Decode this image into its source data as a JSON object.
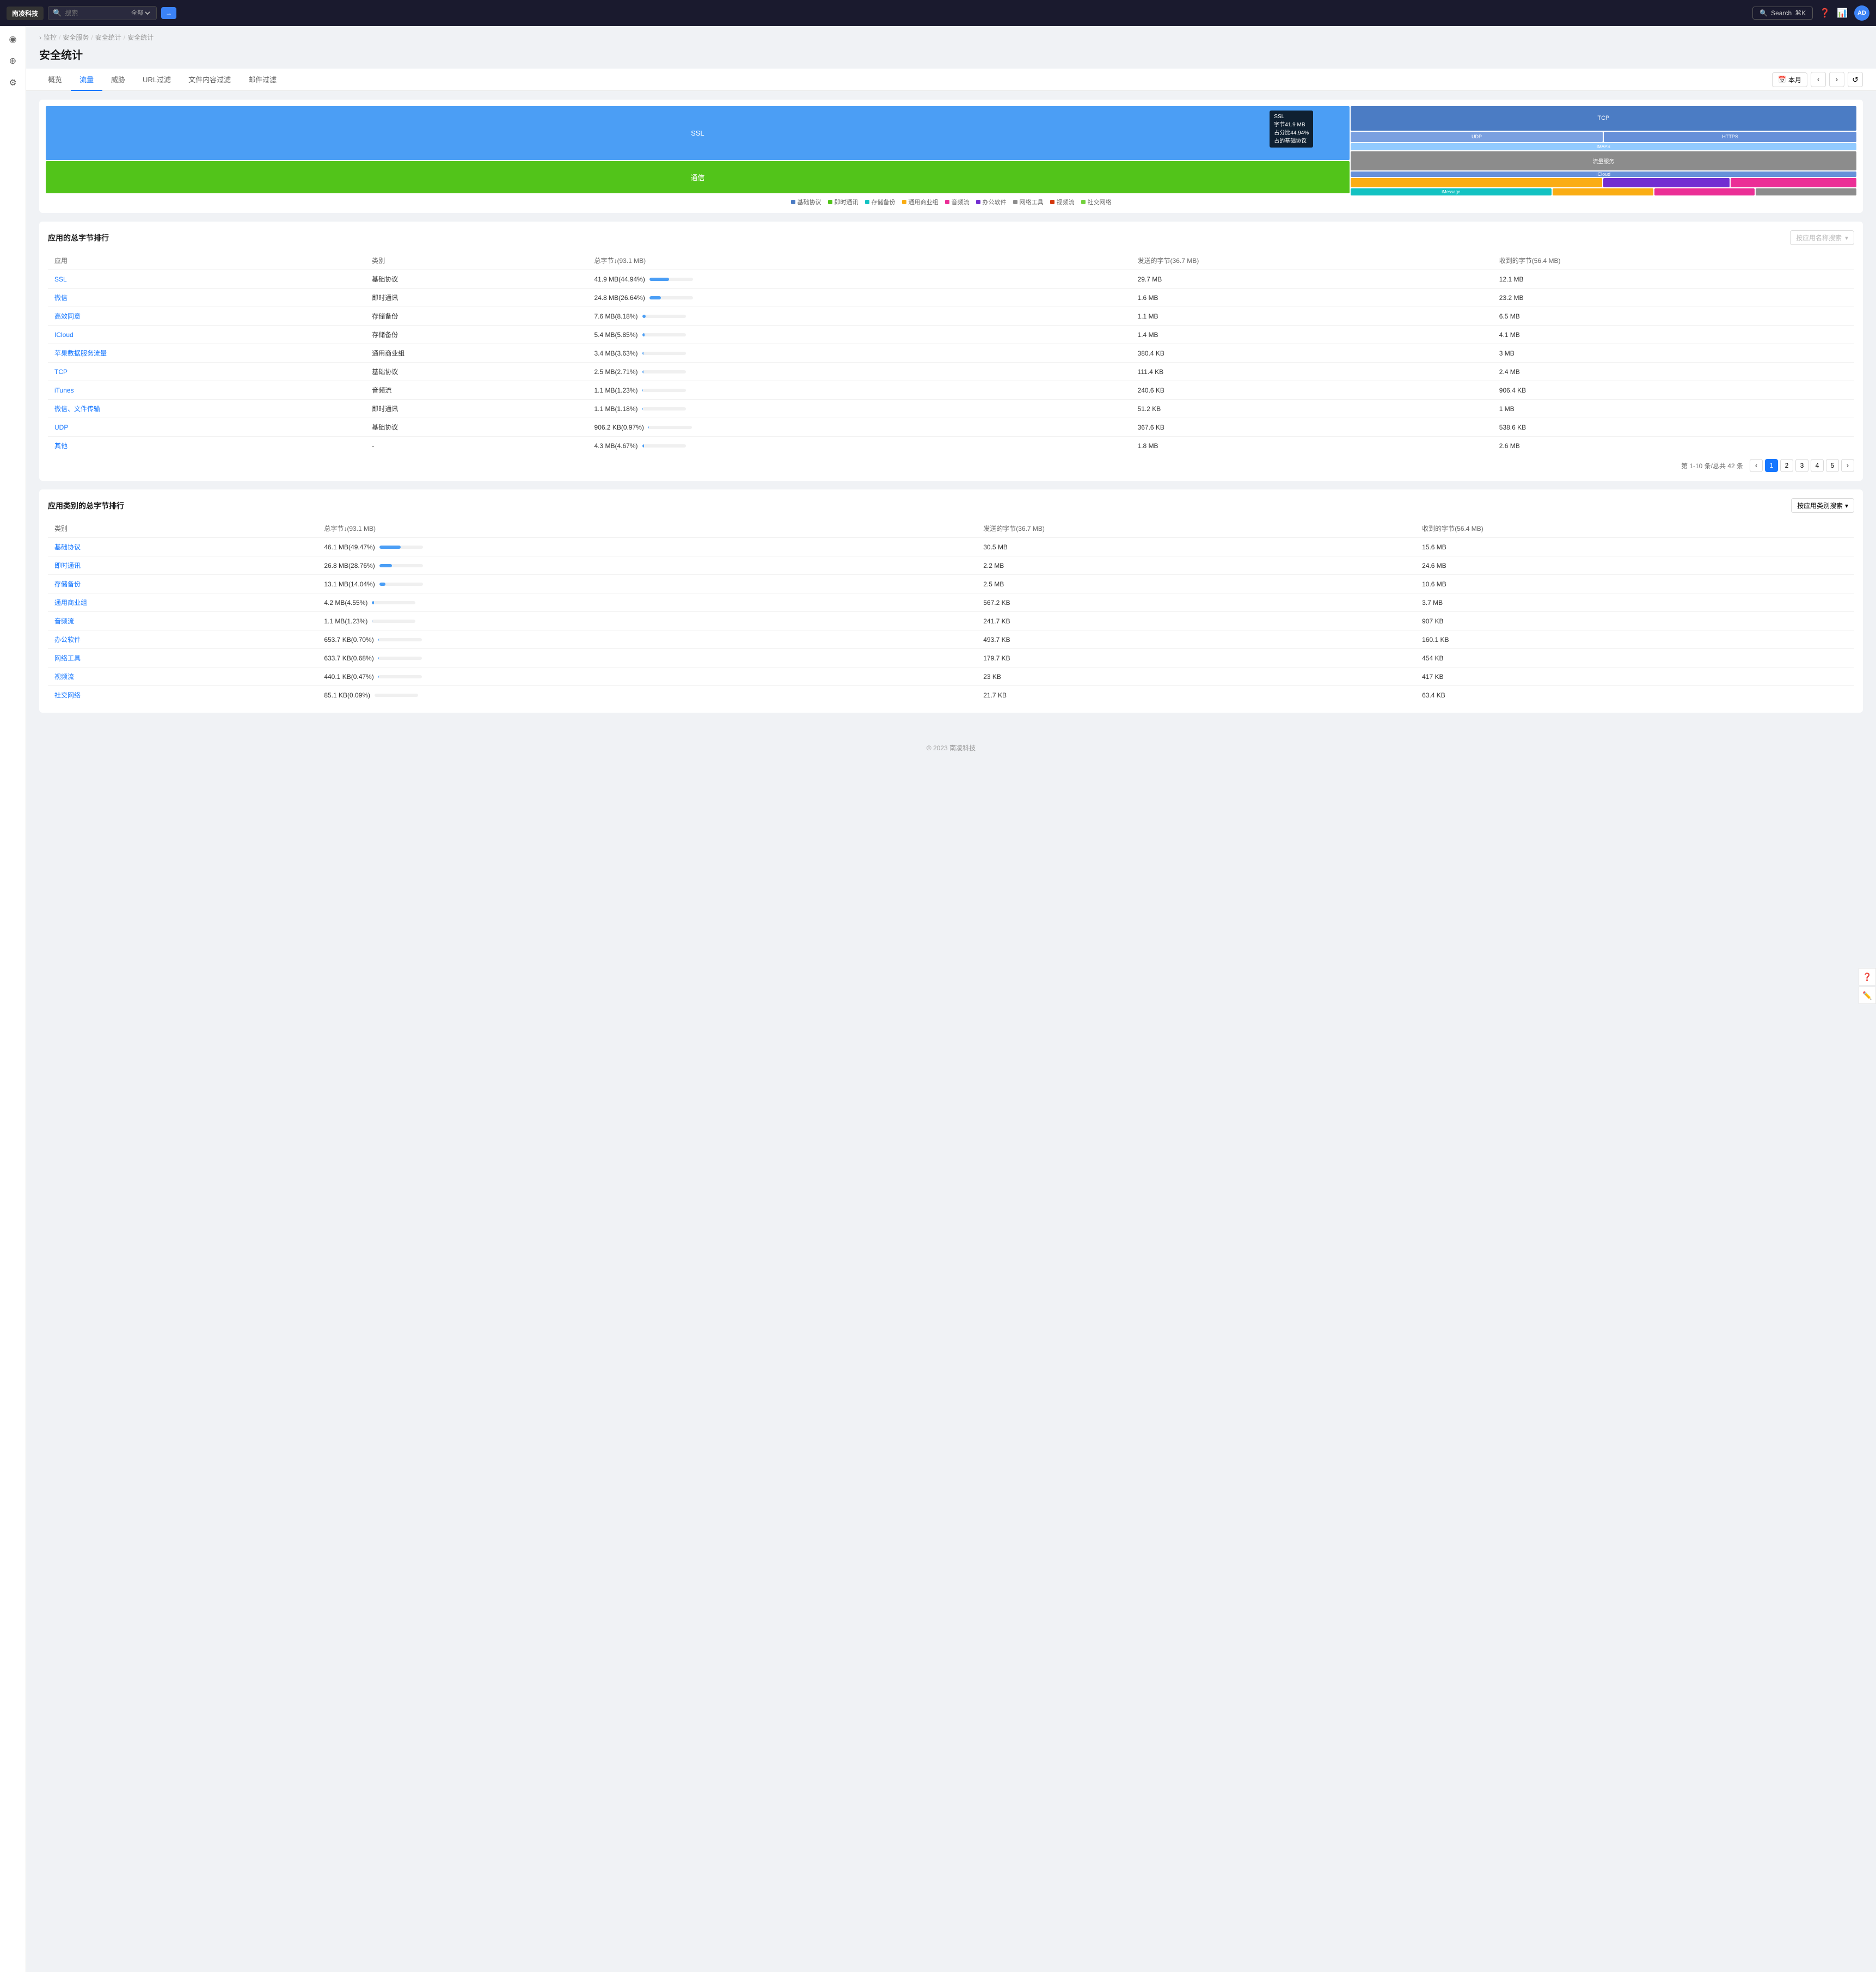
{
  "topnav": {
    "logo": "南凌科技",
    "search_placeholder": "搜索",
    "search_button_label": "→",
    "search_label": "Search",
    "search_shortcut": "⌘K",
    "icons": [
      "question",
      "chart",
      "user"
    ],
    "avatar": "AD"
  },
  "sidebar": {
    "items": [
      {
        "label": "monitor-icon",
        "icon": "◉"
      },
      {
        "label": "location-icon",
        "icon": "⊕"
      },
      {
        "label": "settings-icon",
        "icon": "⚙"
      }
    ]
  },
  "breadcrumb": {
    "items": [
      "监控",
      "安全服务",
      "安全统计",
      "安全统计"
    ],
    "separator": "/"
  },
  "page_title": "安全统计",
  "tabs": [
    {
      "label": "概览",
      "active": false
    },
    {
      "label": "流量",
      "active": true
    },
    {
      "label": "威胁",
      "active": false
    },
    {
      "label": "URL过滤",
      "active": false
    },
    {
      "label": "文件内容过滤",
      "active": false
    },
    {
      "label": "邮件过滤",
      "active": false
    }
  ],
  "toolbar": {
    "month_label": "本月",
    "prev_label": "‹",
    "next_label": "›",
    "refresh_label": "↺"
  },
  "treemap": {
    "cells": [
      {
        "label": "SSL",
        "color": "#4b9ef5"
      },
      {
        "label": "通信",
        "color": "#52c41a"
      },
      {
        "label": "TCP",
        "color": "#4b7cc4"
      },
      {
        "label": "UDP",
        "color": "#7aa0e0"
      },
      {
        "label": "HTTPS",
        "color": "#6690d9"
      },
      {
        "label": "IMAPS",
        "color": "#91caff"
      },
      {
        "label": "iCloud",
        "color": "#6690d9"
      },
      {
        "label": "流量服务",
        "color": "#faad14"
      },
      {
        "label": "iMessage",
        "color": "#13c2c2"
      }
    ],
    "tooltip": {
      "title": "SSL",
      "bytes": "字节41.9 MB",
      "percent1": "占分比44.94%",
      "protocol": "占的基础协议"
    },
    "legend": [
      {
        "label": "基础协议",
        "color": "#4b7cc4"
      },
      {
        "label": "即时通讯",
        "color": "#52c41a"
      },
      {
        "label": "存储备份",
        "color": "#13c2c2"
      },
      {
        "label": "通用商业组",
        "color": "#faad14"
      },
      {
        "label": "音频流",
        "color": "#eb2f96"
      },
      {
        "label": "办公软件",
        "color": "#722ed1"
      },
      {
        "label": "网络工具",
        "color": "#8c8c8c"
      },
      {
        "label": "视频流",
        "color": "#d4380d"
      },
      {
        "label": "社交网络",
        "color": "#73d13d"
      }
    ]
  },
  "app_bytes_table": {
    "title": "应用的总字节排行",
    "search_placeholder": "按应用名称搜索",
    "columns": [
      "应用",
      "类别",
      "总字节↓(93.1 MB)",
      "发送的字节(36.7 MB)",
      "收到的字节(56.4 MB)"
    ],
    "rows": [
      {
        "app": "SSL",
        "category": "基础协议",
        "total": "41.9 MB(44.94%)",
        "total_pct": 44.94,
        "sent": "29.7 MB",
        "recv": "12.1 MB"
      },
      {
        "app": "微信",
        "category": "即时通讯",
        "total": "24.8 MB(26.64%)",
        "total_pct": 26.64,
        "sent": "1.6 MB",
        "recv": "23.2 MB"
      },
      {
        "app": "高效同意",
        "category": "存储备份",
        "total": "7.6 MB(8.18%)",
        "total_pct": 8.18,
        "sent": "1.1 MB",
        "recv": "6.5 MB"
      },
      {
        "app": "ICloud",
        "category": "存储备份",
        "total": "5.4 MB(5.85%)",
        "total_pct": 5.85,
        "sent": "1.4 MB",
        "recv": "4.1 MB"
      },
      {
        "app": "苹果数据服务流量",
        "category": "通用商业组",
        "total": "3.4 MB(3.63%)",
        "total_pct": 3.63,
        "sent": "380.4 KB",
        "recv": "3 MB"
      },
      {
        "app": "TCP",
        "category": "基础协议",
        "total": "2.5 MB(2.71%)",
        "total_pct": 2.71,
        "sent": "111.4 KB",
        "recv": "2.4 MB"
      },
      {
        "app": "iTunes",
        "category": "音频流",
        "total": "1.1 MB(1.23%)",
        "total_pct": 1.23,
        "sent": "240.6 KB",
        "recv": "906.4 KB"
      },
      {
        "app": "微信、文件传输",
        "category": "即时通讯",
        "total": "1.1 MB(1.18%)",
        "total_pct": 1.18,
        "sent": "51.2 KB",
        "recv": "1 MB"
      },
      {
        "app": "UDP",
        "category": "基础协议",
        "total": "906.2 KB(0.97%)",
        "total_pct": 0.97,
        "sent": "367.6 KB",
        "recv": "538.6 KB"
      },
      {
        "app": "其他",
        "category": "-",
        "total": "4.3 MB(4.67%)",
        "total_pct": 4.67,
        "sent": "1.8 MB",
        "recv": "2.6 MB"
      }
    ],
    "pagination": {
      "info": "第 1-10 条/总共 42 条",
      "pages": [
        "1",
        "2",
        "3",
        "4",
        "5"
      ],
      "current": "1"
    }
  },
  "category_bytes_table": {
    "title": "应用类别的总字节排行",
    "dropdown_label": "按应用类别搜索",
    "columns": [
      "类别",
      "总字节↓(93.1 MB)",
      "发送的字节(36.7 MB)",
      "收到的字节(56.4 MB)"
    ],
    "rows": [
      {
        "category": "基础协议",
        "total": "46.1 MB(49.47%)",
        "total_pct": 49.47,
        "sent": "30.5 MB",
        "recv": "15.6 MB"
      },
      {
        "category": "即时通讯",
        "total": "26.8 MB(28.76%)",
        "total_pct": 28.76,
        "sent": "2.2 MB",
        "recv": "24.6 MB"
      },
      {
        "category": "存储备份",
        "total": "13.1 MB(14.04%)",
        "total_pct": 14.04,
        "sent": "2.5 MB",
        "recv": "10.6 MB"
      },
      {
        "category": "通用商业组",
        "total": "4.2 MB(4.55%)",
        "total_pct": 4.55,
        "sent": "567.2 KB",
        "recv": "3.7 MB"
      },
      {
        "category": "音频流",
        "total": "1.1 MB(1.23%)",
        "total_pct": 1.23,
        "sent": "241.7 KB",
        "recv": "907 KB"
      },
      {
        "category": "办公软件",
        "total": "653.7 KB(0.70%)",
        "total_pct": 0.7,
        "sent": "493.7 KB",
        "recv": "160.1 KB"
      },
      {
        "category": "网络工具",
        "total": "633.7 KB(0.68%)",
        "total_pct": 0.68,
        "sent": "179.7 KB",
        "recv": "454 KB"
      },
      {
        "category": "视频流",
        "total": "440.1 KB(0.47%)",
        "total_pct": 0.47,
        "sent": "23 KB",
        "recv": "417 KB"
      },
      {
        "category": "社交网络",
        "total": "85.1 KB(0.09%)",
        "total_pct": 0.09,
        "sent": "21.7 KB",
        "recv": "63.4 KB"
      }
    ]
  },
  "footer": {
    "text": "© 2023 南凌科技"
  }
}
